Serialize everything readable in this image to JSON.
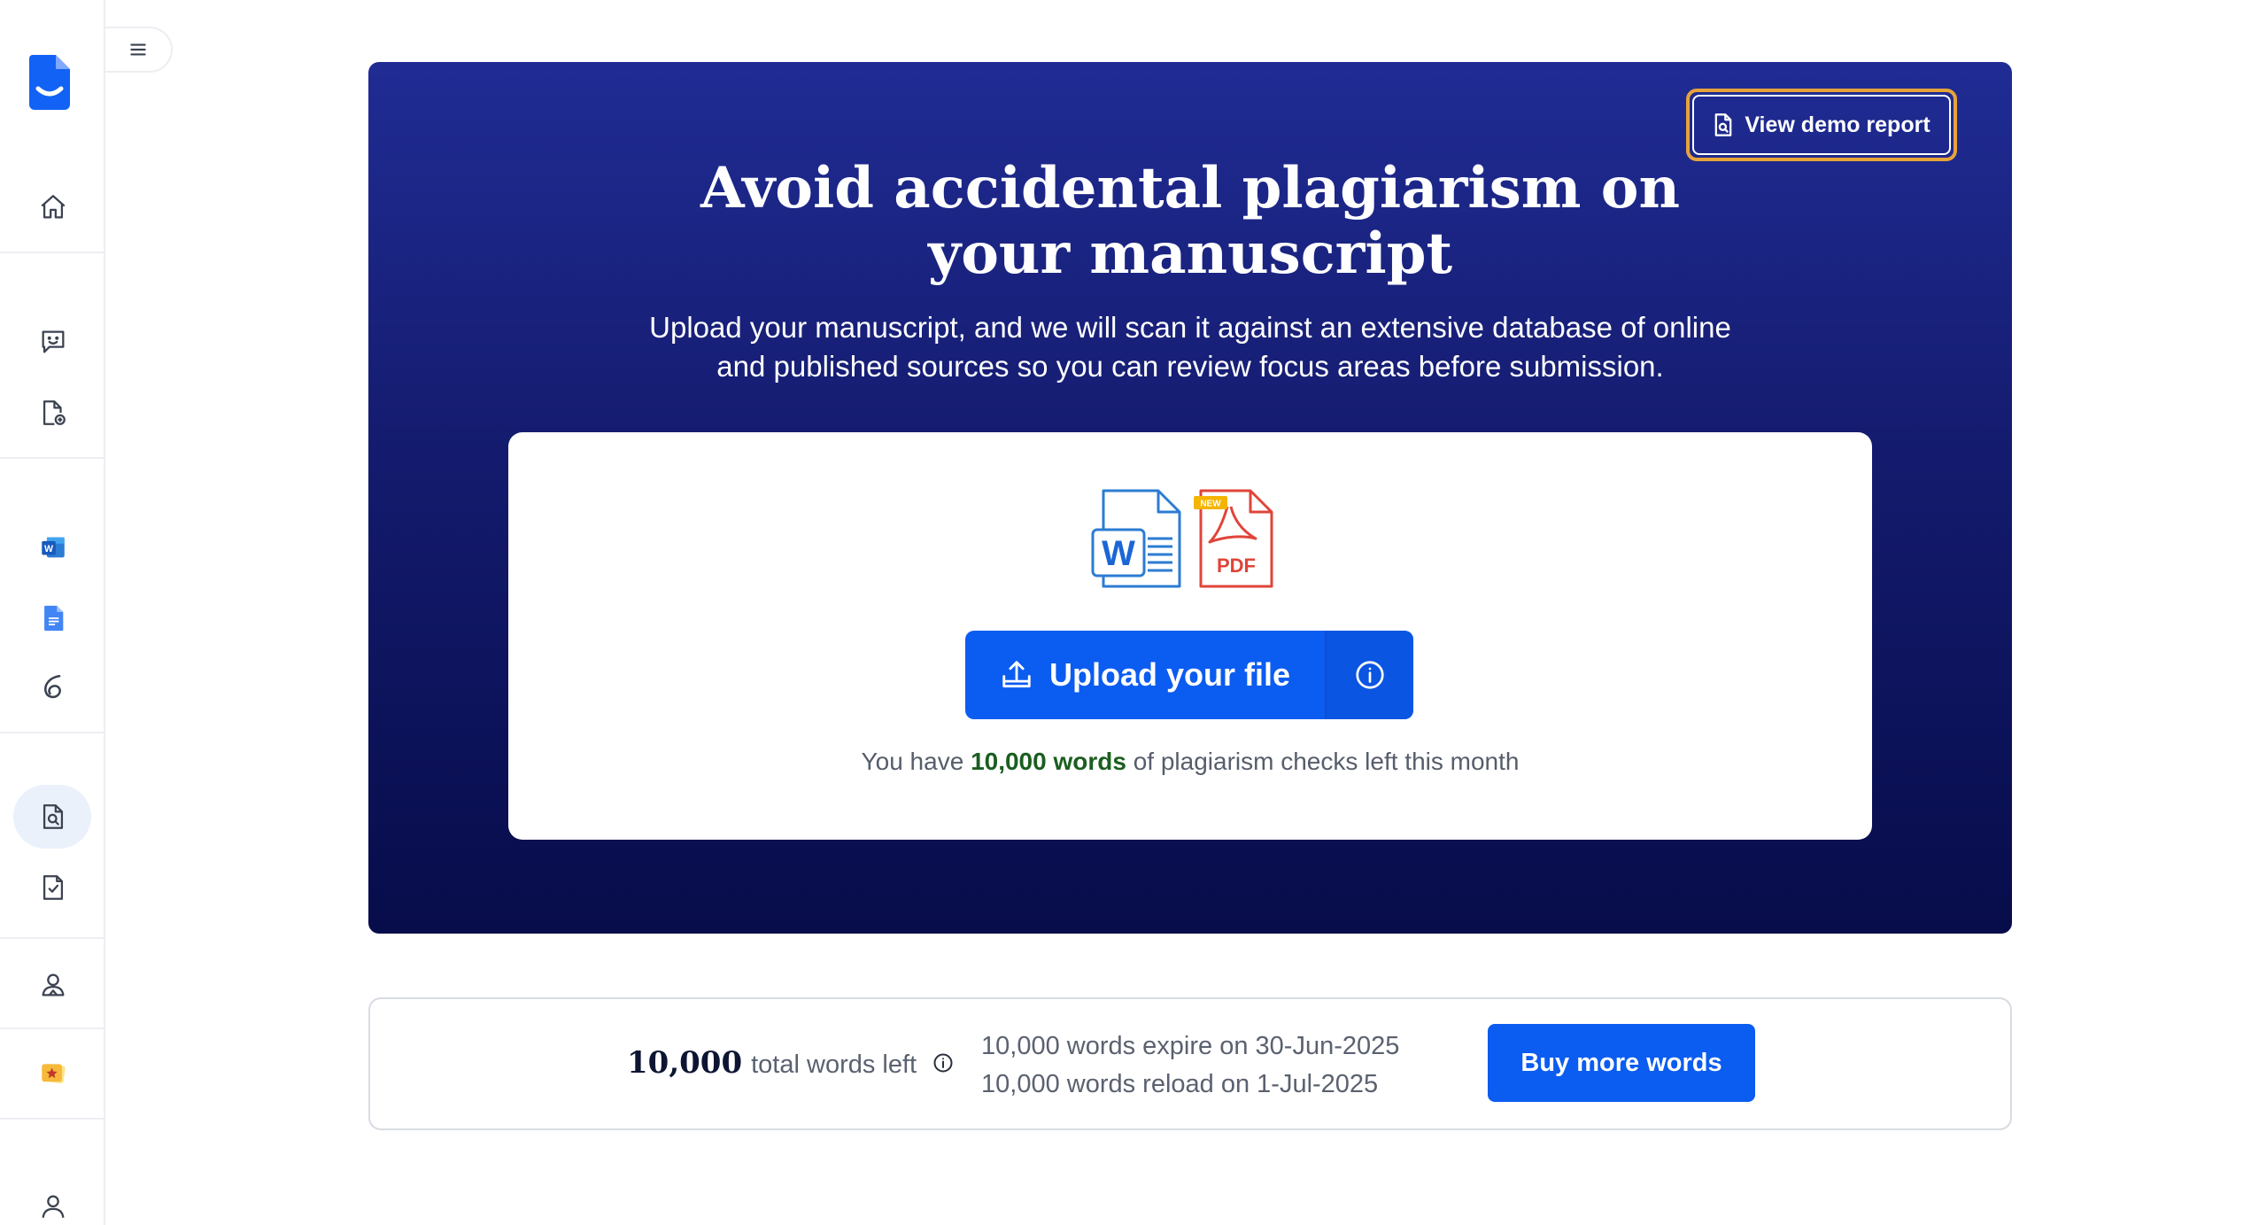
{
  "sidebar": {
    "items": [
      {
        "name": "home",
        "icon": "home-icon"
      },
      {
        "name": "feedback",
        "icon": "chat-smile-icon"
      },
      {
        "name": "add-document",
        "icon": "document-add-icon"
      },
      {
        "name": "word-addin",
        "icon": "word-icon"
      },
      {
        "name": "google-docs",
        "icon": "google-docs-icon"
      },
      {
        "name": "overleaf",
        "icon": "overleaf-icon"
      },
      {
        "name": "plagiarism-check",
        "icon": "document-search-icon",
        "active": true
      },
      {
        "name": "checklist",
        "icon": "document-check-icon"
      },
      {
        "name": "expert-help",
        "icon": "people-icon"
      },
      {
        "name": "premium",
        "icon": "star-icon"
      },
      {
        "name": "account",
        "icon": "user-icon"
      }
    ]
  },
  "hero": {
    "demo_button": "View demo report",
    "title_line1": "Avoid accidental plagiarism on",
    "title_line2": "your manuscript",
    "subtitle_line1": "Upload your manuscript, and we will scan it against an extensive database of online",
    "subtitle_line2": "and published sources so you can review focus areas before submission.",
    "file_icons": {
      "word_letter": "W",
      "pdf_label": "PDF",
      "new_badge": "NEW"
    },
    "upload_button": "Upload your file",
    "words_left_prefix": "You have",
    "words_left_value": "10,000 words",
    "words_left_suffix": "of plagiarism checks left this month"
  },
  "bottom": {
    "total_value": "10,000",
    "total_label": "total words left",
    "expire_line": "10,000 words expire on 30-Jun-2025",
    "reload_line": "10,000 words reload on 1-Jul-2025",
    "buy_button": "Buy more words"
  },
  "colors": {
    "accent_blue": "#0b5cf0",
    "hero_top": "#202c94",
    "hero_bottom": "#070c4a",
    "demo_outline": "#e7a33a",
    "words_highlight": "#1b5e20"
  }
}
